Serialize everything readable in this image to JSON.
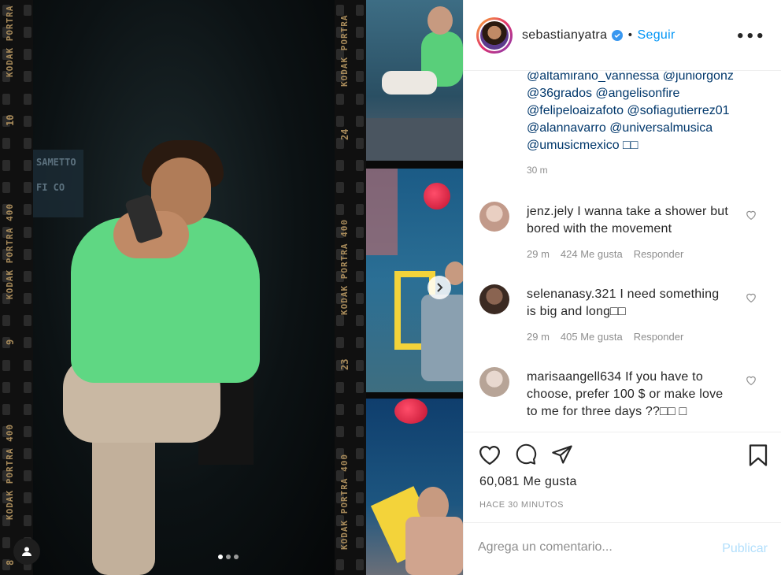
{
  "post": {
    "film_strip": {
      "brand_text": "KODAK PORTRA 400",
      "frame_numbers_left": [
        "10",
        "9",
        "8"
      ],
      "frame_numbers_mid": [
        "24",
        "23"
      ],
      "brand_text_short": "KODAK PORTRA"
    },
    "wall_sign": [
      "SAMETTO",
      "FI  CO"
    ],
    "carousel": {
      "count": 3,
      "active": 0
    }
  },
  "header": {
    "username": "sebastianyatra",
    "verified": true,
    "separator": "•",
    "follow_label": "Seguir",
    "more_label": "•••"
  },
  "caption": {
    "tag_lines": [
      "@altamirano_vannessa @juniorgonz",
      "@36grados @angelisonfire",
      "@felipeloaizafoto @sofiagutierrez01",
      "@alannavarro @universalmusica",
      "@umusicmexico □□"
    ],
    "time": "30 m"
  },
  "comments": [
    {
      "username": "jenz.jely",
      "text": "I wanna take a shower but bored with the movement",
      "time": "29 m",
      "likes": "424 Me gusta",
      "reply_label": "Responder",
      "avatar_color": "#d8b8a8"
    },
    {
      "username": "selenanasy.321",
      "text": "I need something is big and long□□",
      "time": "29 m",
      "likes": "405 Me gusta",
      "reply_label": "Responder",
      "avatar_color": "#6b4a3a"
    },
    {
      "username": "marisaangell634",
      "text": "If you have to choose, prefer 100 $ or make love to me for three days ??□□ □",
      "time": "",
      "likes": "",
      "reply_label": "",
      "avatar_color": "#c9b8ac"
    }
  ],
  "actions": {
    "likes_text": "60,081 Me gusta",
    "posted_text": "HACE 30 MINUTOS"
  },
  "comment_box": {
    "placeholder": "Agrega un comentario...",
    "publish_label": "Publicar"
  },
  "icons": {
    "like": "heart-icon",
    "comment": "comment-icon",
    "share": "share-icon",
    "save": "bookmark-icon",
    "verified": "verified-badge-icon",
    "profile": "user-tag-icon",
    "next": "chevron-right-icon"
  },
  "colors": {
    "link": "#00376b",
    "follow": "#0095f6",
    "muted": "#8e8e8e",
    "publish_disabled": "#b2dffc"
  }
}
